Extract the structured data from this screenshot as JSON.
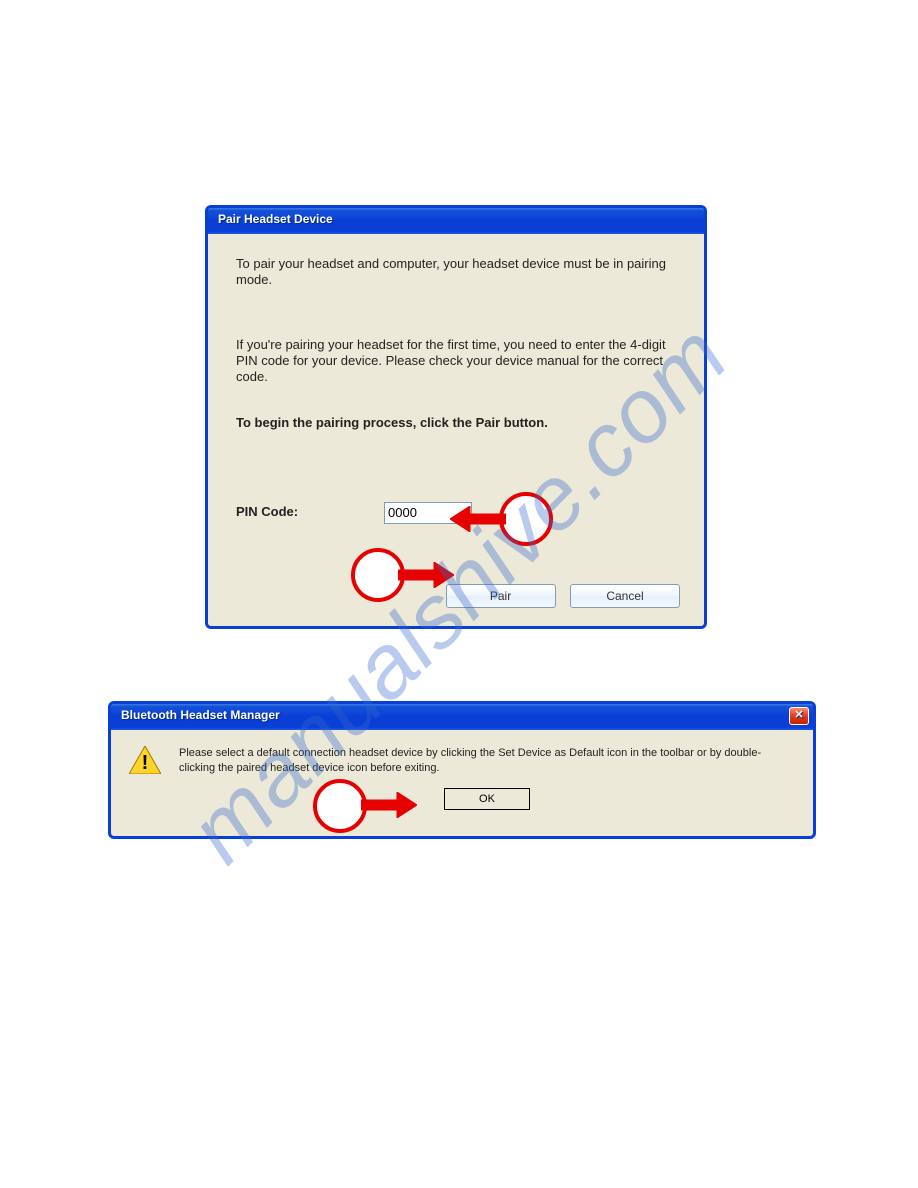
{
  "watermark": "manualshive.com",
  "dialog1": {
    "title": "Pair Headset Device",
    "para1": "To pair your headset and computer, your headset device must be in pairing mode.",
    "para2": "If you're pairing your headset for the first time, you need to enter the 4-digit PIN code for your device. Please check your device manual for the correct code.",
    "para3": "To begin the pairing process, click the Pair button.",
    "pin_label": "PIN Code:",
    "pin_value": "0000",
    "pair_label": "Pair",
    "cancel_label": "Cancel"
  },
  "dialog2": {
    "title": "Bluetooth Headset Manager",
    "message": "Please select a default connection headset device by clicking the Set Device as Default icon in the toolbar or by double-clicking the paired headset device icon before exiting.",
    "ok_label": "OK",
    "close_x": "✕"
  }
}
